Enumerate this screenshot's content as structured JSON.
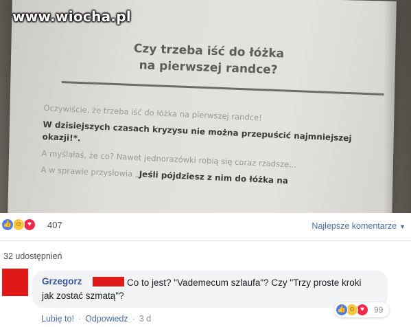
{
  "watermark": "www.wiocha.pl",
  "book": {
    "title_line1": "Czy trzeba iść do łóżka",
    "title_line2": "na pierwszej randce?",
    "para1": "Oczywiście, że trzeba iść do łóżka na pierwszej randce!",
    "para2": "W dzisiejszych czasach kryzysu nie można przepuścić najmniejszej okazji!*.",
    "para3": "A myślałaś, że co? Nawet jednorazówki robią się coraz rzadsze...",
    "para4a": "A w sprawie przysłowia „",
    "para4b": "Jeśli pójdziesz z nim do łóżka na"
  },
  "reactions": {
    "count": "407",
    "icons": [
      "like-icon",
      "haha-icon",
      "love-icon"
    ],
    "sort_label": "Najlepsze komentarze"
  },
  "shares": "32 udostępnień",
  "comment": {
    "author": "Grzegorz",
    "text": "Co to jest? \"Vademecum szlaufa\"? Czy \"Trzy proste kroki jak zostać szmatą\"?",
    "reaction_count": "99",
    "like_label": "Lubię to!",
    "reply_label": "Odpowiedz",
    "time": "3 d"
  },
  "colors": {
    "accent": "#4b6ea8",
    "author": "#385898",
    "redaction": "#e01818",
    "like": "#4e7fe8",
    "haha": "#f7c842",
    "love": "#f0284a"
  }
}
